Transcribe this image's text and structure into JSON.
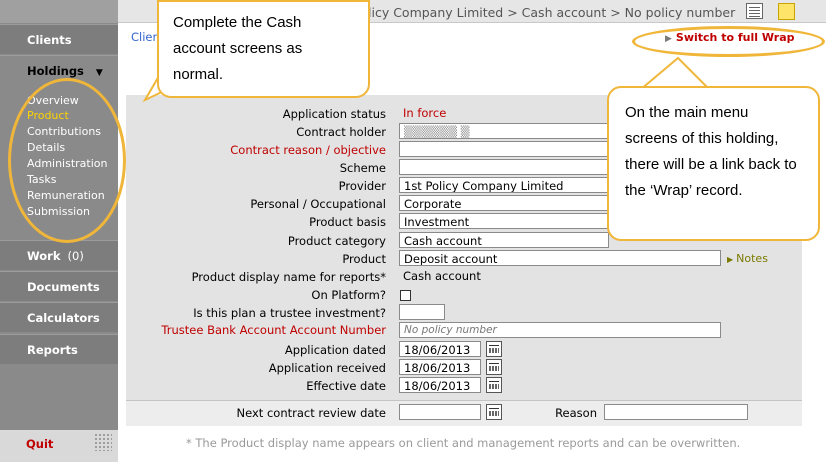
{
  "header": {
    "breadcrumb": "licy Company Limited > Cash account > No policy number"
  },
  "sidebar": {
    "clients": "Clients",
    "holdings": "Holdings",
    "holdings_arrow": "▼",
    "sub_items": [
      "Overview",
      "Product",
      "Contributions",
      "Details",
      "Administration",
      "Tasks",
      "Remuneration",
      "Submission"
    ],
    "active_item": "Product",
    "work": "Work",
    "work_count": "(0)",
    "documents": "Documents",
    "calculators": "Calculators",
    "reports": "Reports",
    "quit": "Quit"
  },
  "content": {
    "clients_link": "Clien",
    "switch_link": "Switch to full Wrap"
  },
  "form": {
    "application_status_label": "Application status",
    "application_status_value": "In force",
    "contract_holder_label": "Contract holder",
    "contract_holder_value": "▒▒▒▒▒▒ ▒",
    "contract_reason_label": "Contract reason / objective",
    "scheme_label": "Scheme",
    "provider_label": "Provider",
    "provider_value": "1st Policy Company Limited",
    "personal_label": "Personal / Occupational",
    "personal_value": "Corporate",
    "product_basis_label": "Product basis",
    "product_basis_value": "Investment",
    "product_category_label": "Product category",
    "product_category_value": "Cash account",
    "product_label": "Product",
    "product_value": "Deposit account",
    "notes_label": "Notes",
    "display_name_label": "Product display name for reports*",
    "display_name_value": "Cash account",
    "on_platform_label": "On Platform?",
    "trustee_label": "Is this plan a trustee investment?",
    "trustee_bank_label": "Trustee Bank Account Account Number",
    "trustee_bank_placeholder": "No policy number",
    "app_dated_label": "Application dated",
    "app_dated_value": "18/06/2013",
    "app_received_label": "Application received",
    "app_received_value": "18/06/2013",
    "effective_label": "Effective date",
    "effective_value": "18/06/2013",
    "review_label": "Next contract review date",
    "reason_label": "Reason"
  },
  "footer_note": "* The Product display name appears on client and management reports and can be overwritten.",
  "callouts": {
    "top": "Complete the Cash account screens as normal.",
    "right": "On the main menu screens of this holding, there will be a link back to the ‘Wrap’ record."
  },
  "colors": {
    "callout_border": "#f0b63a",
    "alert_red": "#c00000",
    "active_nav": "#ffd400"
  }
}
